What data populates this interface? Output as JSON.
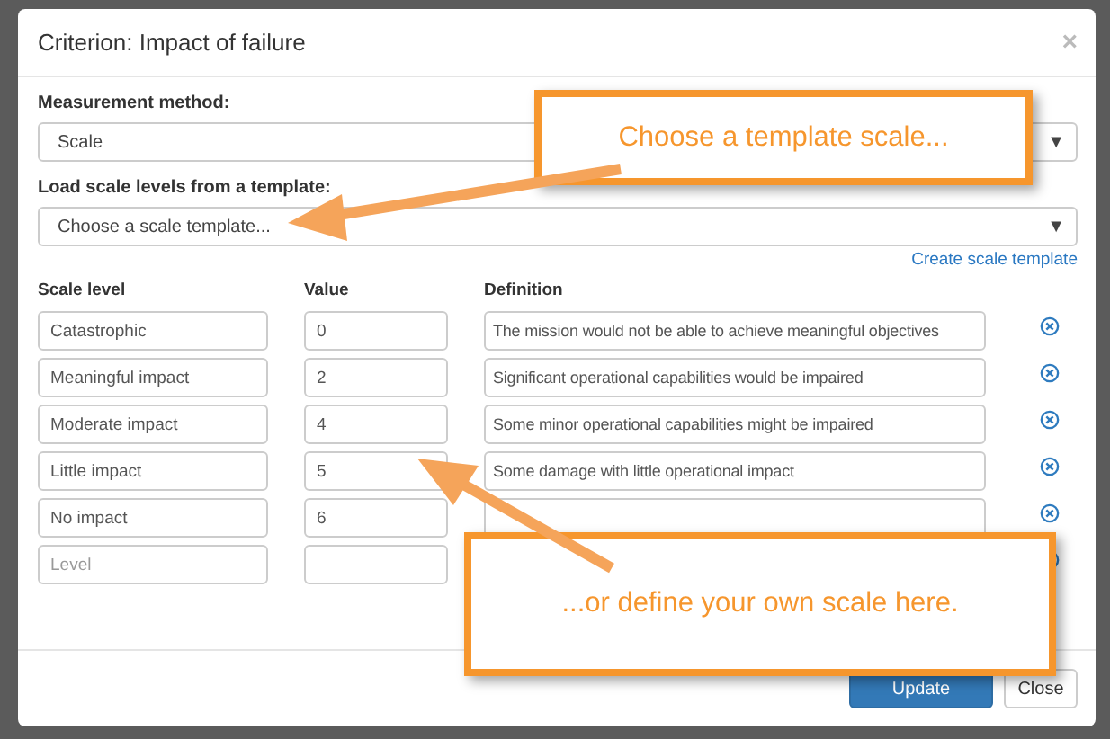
{
  "dialog": {
    "title": "Criterion: Impact of failure",
    "close": "×"
  },
  "measurement": {
    "label": "Measurement method:",
    "value": "Scale",
    "caret": "▼"
  },
  "template": {
    "label": "Load scale levels from a template:",
    "value": "Choose a scale template...",
    "caret": "▼",
    "link": "Create scale template"
  },
  "table": {
    "columns": [
      "Scale level",
      "Value",
      "Definition"
    ],
    "rows": [
      {
        "level": "Catastrophic",
        "value": "0",
        "definition": "The mission would not be able to achieve meaningful objectives"
      },
      {
        "level": "Meaningful impact",
        "value": "2",
        "definition": "Significant operational capabilities would be impaired"
      },
      {
        "level": "Moderate impact",
        "value": "4",
        "definition": "Some minor operational capabilities might be impaired"
      },
      {
        "level": "Little impact",
        "value": "5",
        "definition": "Some damage with little operational impact"
      },
      {
        "level": "No impact",
        "value": "6"
      },
      {
        "level_placeholder": "Level"
      }
    ]
  },
  "buttons": [
    {
      "label": "Update",
      "kind": "primary"
    },
    {
      "label": "Close",
      "kind": "default"
    }
  ],
  "callouts": [
    {
      "text": "Choose a template scale..."
    },
    {
      "text": "...or define your own scale here."
    }
  ]
}
